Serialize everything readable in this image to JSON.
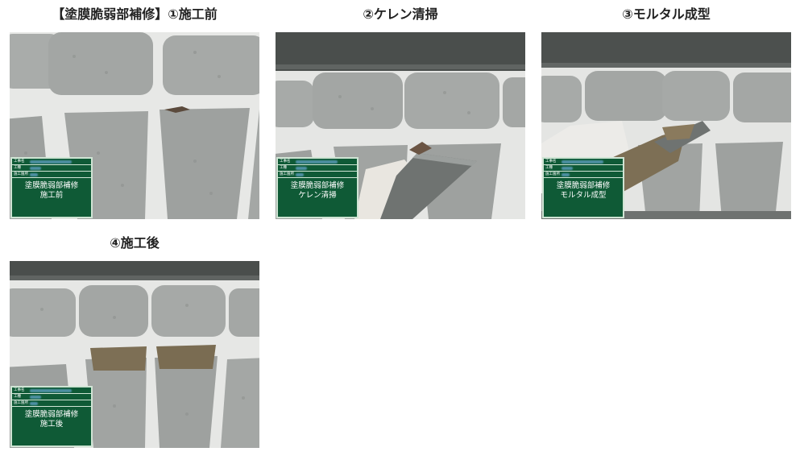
{
  "panels": [
    {
      "id": "before",
      "caption": "【塗膜脆弱部補修】①施工前",
      "board": {
        "keys": [
          "工事名",
          "工種",
          "施工箇所"
        ],
        "line1": "塗膜脆弱部補修",
        "line2": "施工前"
      },
      "variant": "before"
    },
    {
      "id": "cleaning",
      "caption": "②ケレン清掃",
      "board": {
        "keys": [
          "工事名",
          "工種",
          "施工箇所"
        ],
        "line1": "塗膜脆弱部補修",
        "line2": "ケレン清掃"
      },
      "variant": "scraper"
    },
    {
      "id": "mortar",
      "caption": "③モルタル成型",
      "board": {
        "keys": [
          "工事名",
          "工種",
          "施工箇所"
        ],
        "line1": "塗膜脆弱部補修",
        "line2": "モルタル成型"
      },
      "variant": "trowel"
    },
    {
      "id": "after",
      "caption": "④施工後",
      "board": {
        "keys": [
          "工事名",
          "工種",
          "施工箇所"
        ],
        "line1": "塗膜脆弱部補修",
        "line2": "施工後"
      },
      "variant": "after"
    }
  ],
  "colors": {
    "board_green": "#0f5a36",
    "board_border": "#cfe4d4",
    "mortar": "#7d6f55",
    "stone": "#a7aaa8"
  }
}
